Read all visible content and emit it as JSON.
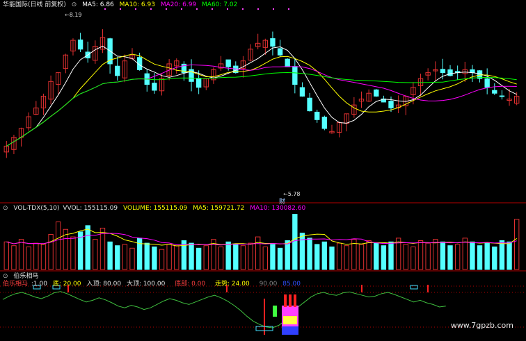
{
  "main_header": {
    "title": "华能国际(日线 前复权)",
    "ma5": "MA5: 6.86",
    "ma10": "MA10: 6.93",
    "ma20": "MA20: 6.99",
    "ma60": "MA60: 7.02"
  },
  "vol_header": {
    "name": "VOL-TDX(5,10)",
    "vvol": "VVOL: 155115.09",
    "volume": "VOLUME: 155115.09",
    "ma5": "MA5: 159721.72",
    "ma10": "MA10: 130082.60"
  },
  "ind_header": {
    "name": "伯乐相马",
    "sub": "伯乐相马",
    "v1": ":1.00",
    "di": "底: 20.00",
    "ru": "入顶: 80.00",
    "da": "大顶: 100.00",
    "dibu": "底部: 0.00",
    "zoushi": "走势: 24.00",
    "n90": "90.00",
    "n85": "85.00"
  },
  "annotations": {
    "high_label": "8.19",
    "low_label": "5.78",
    "cai_label": "财",
    "watermark": "www.7gpzb.com"
  },
  "colors": {
    "up": "#e03030",
    "down": "#54ffff",
    "ma5": "#ffffff",
    "ma10": "#ffff00",
    "ma20": "#ff00ff",
    "ma60": "#00ff00",
    "ind_line": "#3fbf3f",
    "panel_border": "#b40000"
  },
  "chart_data": [
    {
      "type": "candlestick",
      "title": "华能国际(日线 前复权)",
      "series": [
        {
          "name": "MA5",
          "value": 6.86
        },
        {
          "name": "MA10",
          "value": 6.93
        },
        {
          "name": "MA20",
          "value": 6.99
        },
        {
          "name": "MA60",
          "value": 7.02
        }
      ],
      "closes": [
        6.05,
        6.2,
        6.35,
        6.55,
        6.7,
        6.9,
        7.15,
        7.3,
        7.6,
        7.85,
        7.7,
        7.55,
        7.75,
        7.9,
        7.45,
        7.25,
        7.5,
        7.6,
        7.35,
        7.1,
        7.0,
        7.2,
        7.45,
        7.5,
        7.3,
        7.15,
        7.05,
        7.2,
        7.35,
        7.45,
        7.4,
        7.3,
        7.5,
        7.7,
        7.8,
        7.85,
        7.75,
        7.6,
        7.4,
        7.1,
        6.9,
        6.65,
        6.5,
        6.35,
        6.3,
        6.45,
        6.6,
        6.75,
        6.85,
        6.95,
        6.9,
        6.8,
        6.7,
        6.75,
        6.9,
        7.05,
        7.2,
        7.3,
        7.35,
        7.3,
        7.25,
        7.3,
        7.35,
        7.3,
        7.2,
        7.05,
        6.95,
        6.9,
        6.85,
        6.9
      ],
      "high": 8.19,
      "low": 5.78
    },
    {
      "type": "bar",
      "title": "VOL-TDX(5,10)",
      "series": [
        {
          "name": "VVOL",
          "value": 155115.09
        },
        {
          "name": "VOLUME",
          "value": 155115.09
        },
        {
          "name": "MA5",
          "value": 159721.72
        },
        {
          "name": "MA10",
          "value": 130082.6
        }
      ],
      "values": [
        110,
        95,
        120,
        90,
        105,
        100,
        140,
        190,
        160,
        130,
        150,
        175,
        120,
        165,
        110,
        95,
        100,
        85,
        125,
        105,
        90,
        80,
        100,
        95,
        115,
        105,
        85,
        95,
        120,
        90,
        110,
        100,
        95,
        105,
        130,
        90,
        100,
        85,
        115,
        220,
        145,
        125,
        100,
        110,
        90,
        105,
        95,
        120,
        100,
        115,
        105,
        95,
        110,
        125,
        100,
        90,
        115,
        105,
        120,
        110,
        95,
        100,
        125,
        110,
        95,
        105,
        90,
        115,
        110,
        200
      ]
    },
    {
      "type": "line",
      "title": "伯乐相马",
      "series": [
        {
          "name": "伯乐相马",
          "value": 1.0
        },
        {
          "name": "底",
          "value": 20.0
        },
        {
          "name": "入顶",
          "value": 80.0
        },
        {
          "name": "大顶",
          "value": 100.0
        },
        {
          "name": "底部",
          "value": 0.0
        },
        {
          "name": "走势",
          "value": 24.0
        }
      ],
      "values": [
        78,
        86,
        92,
        95,
        90,
        84,
        80,
        86,
        94,
        97,
        92,
        85,
        78,
        72,
        76,
        82,
        77,
        70,
        62,
        58,
        64,
        60,
        54,
        58,
        66,
        74,
        80,
        76,
        70,
        66,
        72,
        78,
        84,
        88,
        82,
        74,
        64,
        52,
        38,
        26,
        18,
        12,
        10,
        16,
        28,
        44,
        60,
        72,
        84,
        92,
        95,
        90,
        88,
        94,
        96,
        92,
        88,
        84,
        86,
        92,
        95,
        90,
        84,
        78,
        72,
        76,
        70,
        66,
        60,
        62
      ]
    }
  ]
}
